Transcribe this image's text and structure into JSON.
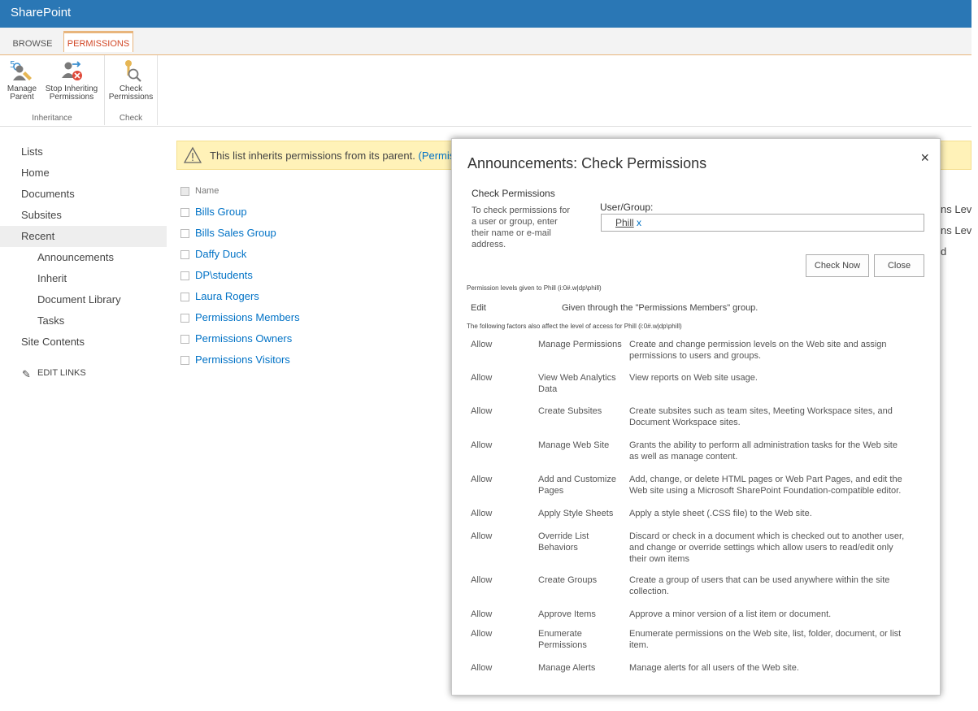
{
  "suite_bar": {
    "brand": "SharePoint"
  },
  "ribbon": {
    "tabs": [
      {
        "label": "BROWSE"
      },
      {
        "label": "PERMISSIONS"
      }
    ],
    "groups": {
      "inheritance": {
        "label": "Inheritance",
        "buttons": [
          {
            "label_line1": "Manage",
            "label_line2": "Parent"
          },
          {
            "label_line1": "Stop Inheriting",
            "label_line2": "Permissions"
          }
        ]
      },
      "check": {
        "label": "Check",
        "buttons": [
          {
            "label_line1": "Check",
            "label_line2": "Permissions"
          }
        ]
      }
    }
  },
  "left_nav": {
    "items": [
      {
        "label": "Lists"
      },
      {
        "label": "Home"
      },
      {
        "label": "Documents"
      },
      {
        "label": "Subsites"
      },
      {
        "label": "Recent"
      },
      {
        "label": "Announcements"
      },
      {
        "label": "Inherit"
      },
      {
        "label": "Document Library"
      },
      {
        "label": "Tasks"
      },
      {
        "label": "Site Contents"
      }
    ],
    "edit_links": "EDIT LINKS"
  },
  "banner": {
    "text": "This list inherits permissions from its parent.",
    "link": "(Permissio"
  },
  "list": {
    "header": "Name",
    "rows": [
      {
        "name": "Bills Group"
      },
      {
        "name": "Bills Sales Group"
      },
      {
        "name": "Daffy Duck"
      },
      {
        "name": "DP\\students"
      },
      {
        "name": "Laura Rogers"
      },
      {
        "name": "Permissions Members"
      },
      {
        "name": "Permissions Owners"
      },
      {
        "name": "Permissions Visitors"
      }
    ],
    "right_fragments": [
      "ns Level",
      "ns Level",
      "d"
    ]
  },
  "dialog": {
    "title": "Announcements: Check Permissions",
    "close_glyph": "×",
    "section_title": "Check Permissions",
    "description": "To check permissions for a user or group, enter their name or e-mail address.",
    "user_group_label": "User/Group:",
    "user_value": "Phill",
    "user_remove": "x",
    "check_now": "Check Now",
    "close": "Close",
    "levels_note": "Permission levels given to Phill (i:0#.w|dp\\phill)",
    "level_name": "Edit",
    "level_desc": "Given through the \"Permissions Members\" group.",
    "factors_note": "The following factors also affect the level of access for Phill (i:0#.w|dp\\phill)",
    "permissions": [
      {
        "status": "Allow",
        "name": "Manage Permissions",
        "desc": "Create and change permission levels on the Web site and assign permissions to users and groups."
      },
      {
        "status": "Allow",
        "name": "View Web Analytics Data",
        "desc": "View reports on Web site usage."
      },
      {
        "status": "Allow",
        "name": "Create Subsites",
        "desc": "Create subsites such as team sites, Meeting Workspace sites, and Document Workspace sites."
      },
      {
        "status": "Allow",
        "name": "Manage Web Site",
        "desc": "Grants the ability to perform all administration tasks for the Web site as well as manage content."
      },
      {
        "status": "Allow",
        "name": "Add and Customize Pages",
        "desc": "Add, change, or delete HTML pages or Web Part Pages, and edit the Web site using a Microsoft SharePoint Foundation-compatible editor."
      },
      {
        "status": "Allow",
        "name": "Apply Style Sheets",
        "desc": "Apply a style sheet (.CSS file) to the Web site."
      },
      {
        "status": "Allow",
        "name": "Override List Behaviors",
        "desc": "Discard or check in a document which is checked out to another user, and change or override settings which allow users to read/edit only their own items"
      },
      {
        "status": "Allow",
        "name": "Create Groups",
        "desc": "Create a group of users that can be used anywhere within the site collection."
      },
      {
        "status": "Allow",
        "name": "Approve Items",
        "desc": "Approve a minor version of a list item or document."
      },
      {
        "status": "Allow",
        "name": "Enumerate Permissions",
        "desc": "Enumerate permissions on the Web site, list, folder, document, or list item."
      },
      {
        "status": "Allow",
        "name": "Manage Alerts",
        "desc": "Manage alerts for all users of the Web site."
      }
    ]
  },
  "colors": {
    "suite_bar": "#2a77b5",
    "accent_orange": "#d24726",
    "link_blue": "#0072c6",
    "banner_yellow": "#fff2b8"
  }
}
